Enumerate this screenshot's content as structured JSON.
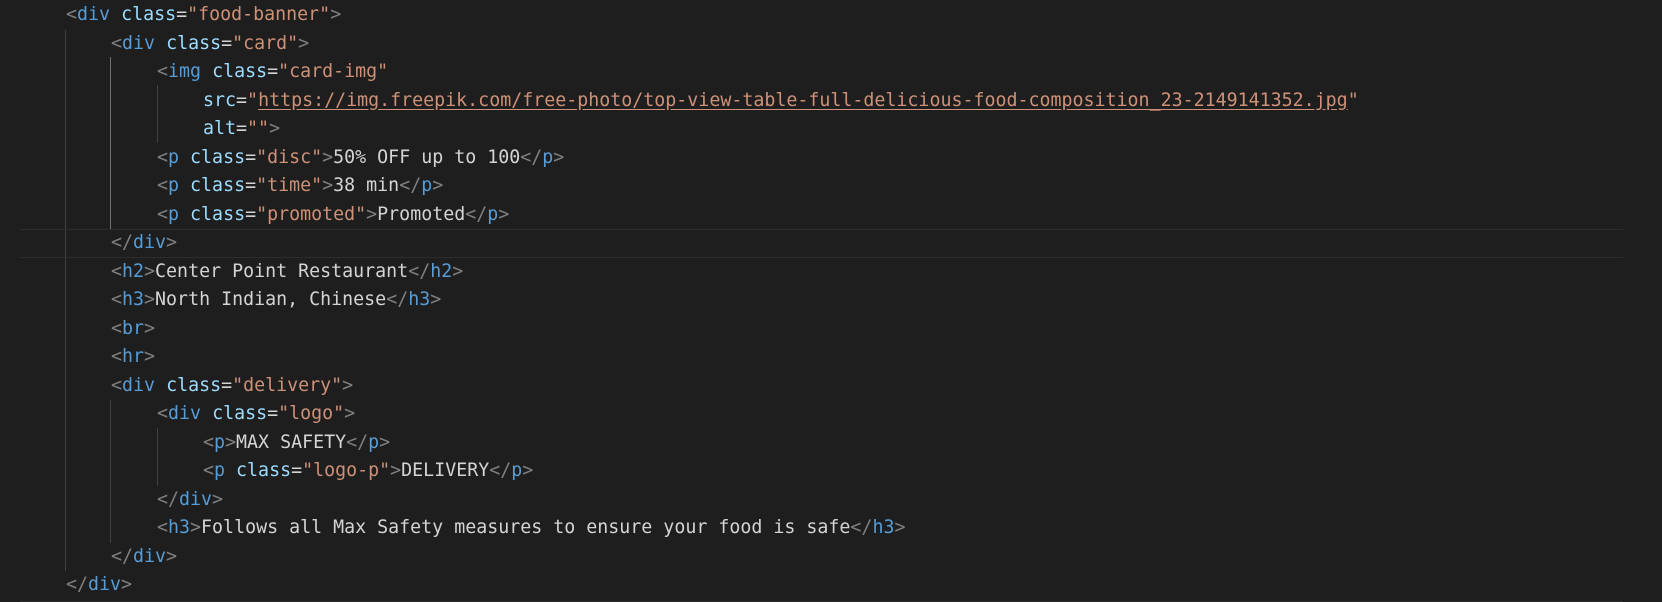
{
  "editor": {
    "lines": [
      {
        "parts": [
          [
            "t",
            "<"
          ],
          [
            "tag",
            "div"
          ],
          [
            "txt",
            " "
          ],
          [
            "attr",
            "class"
          ],
          [
            "txt",
            "="
          ],
          [
            "str",
            "\"food-banner\""
          ],
          [
            "t",
            ">"
          ]
        ]
      },
      {
        "parts": [
          [
            "t",
            "<"
          ],
          [
            "tag",
            "div"
          ],
          [
            "txt",
            " "
          ],
          [
            "attr",
            "class"
          ],
          [
            "txt",
            "="
          ],
          [
            "str",
            "\"card\""
          ],
          [
            "t",
            ">"
          ]
        ]
      },
      {
        "parts": [
          [
            "t",
            "<"
          ],
          [
            "tag",
            "img"
          ],
          [
            "txt",
            " "
          ],
          [
            "attr",
            "class"
          ],
          [
            "txt",
            "="
          ],
          [
            "str",
            "\"card-img\""
          ]
        ]
      },
      {
        "parts": [
          [
            "attr",
            "src"
          ],
          [
            "txt",
            "="
          ],
          [
            "str",
            "\""
          ],
          [
            "url",
            "https://img.freepik.com/free-photo/top-view-table-full-delicious-food-composition_23-2149141352.jpg"
          ],
          [
            "str",
            "\""
          ]
        ]
      },
      {
        "parts": [
          [
            "attr",
            "alt"
          ],
          [
            "txt",
            "="
          ],
          [
            "str",
            "\"\""
          ],
          [
            "t",
            ">"
          ]
        ]
      },
      {
        "parts": [
          [
            "t",
            "<"
          ],
          [
            "tag",
            "p"
          ],
          [
            "txt",
            " "
          ],
          [
            "attr",
            "class"
          ],
          [
            "txt",
            "="
          ],
          [
            "str",
            "\"disc\""
          ],
          [
            "t",
            ">"
          ],
          [
            "txt",
            "50% OFF up to 100"
          ],
          [
            "t",
            "</"
          ],
          [
            "tag",
            "p"
          ],
          [
            "t",
            ">"
          ]
        ]
      },
      {
        "parts": [
          [
            "t",
            "<"
          ],
          [
            "tag",
            "p"
          ],
          [
            "txt",
            " "
          ],
          [
            "attr",
            "class"
          ],
          [
            "txt",
            "="
          ],
          [
            "str",
            "\"time\""
          ],
          [
            "t",
            ">"
          ],
          [
            "txt",
            "38 min"
          ],
          [
            "t",
            "</"
          ],
          [
            "tag",
            "p"
          ],
          [
            "t",
            ">"
          ]
        ]
      },
      {
        "parts": [
          [
            "t",
            "<"
          ],
          [
            "tag",
            "p"
          ],
          [
            "txt",
            " "
          ],
          [
            "attr",
            "class"
          ],
          [
            "txt",
            "="
          ],
          [
            "str",
            "\"promoted\""
          ],
          [
            "t",
            ">"
          ],
          [
            "txt",
            "Promoted"
          ],
          [
            "t",
            "</"
          ],
          [
            "tag",
            "p"
          ],
          [
            "t",
            ">"
          ]
        ]
      },
      {
        "parts": [
          [
            "t",
            "</"
          ],
          [
            "tag",
            "div"
          ],
          [
            "t",
            ">"
          ]
        ]
      },
      {
        "parts": [
          [
            "t",
            "<"
          ],
          [
            "tag",
            "h2"
          ],
          [
            "t",
            ">"
          ],
          [
            "txt",
            "Center Point Restaurant"
          ],
          [
            "t",
            "</"
          ],
          [
            "tag",
            "h2"
          ],
          [
            "t",
            ">"
          ]
        ]
      },
      {
        "parts": [
          [
            "t",
            "<"
          ],
          [
            "tag",
            "h3"
          ],
          [
            "t",
            ">"
          ],
          [
            "txt",
            "North Indian, Chinese"
          ],
          [
            "t",
            "</"
          ],
          [
            "tag",
            "h3"
          ],
          [
            "t",
            ">"
          ]
        ]
      },
      {
        "parts": [
          [
            "t",
            "<"
          ],
          [
            "tag",
            "br"
          ],
          [
            "t",
            ">"
          ]
        ]
      },
      {
        "parts": [
          [
            "t",
            "<"
          ],
          [
            "tag",
            "hr"
          ],
          [
            "t",
            ">"
          ]
        ]
      },
      {
        "parts": [
          [
            "t",
            "<"
          ],
          [
            "tag",
            "div"
          ],
          [
            "txt",
            " "
          ],
          [
            "attr",
            "class"
          ],
          [
            "txt",
            "="
          ],
          [
            "str",
            "\"delivery\""
          ],
          [
            "t",
            ">"
          ]
        ]
      },
      {
        "parts": [
          [
            "t",
            "<"
          ],
          [
            "tag",
            "div"
          ],
          [
            "txt",
            " "
          ],
          [
            "attr",
            "class"
          ],
          [
            "txt",
            "="
          ],
          [
            "str",
            "\"logo\""
          ],
          [
            "t",
            ">"
          ]
        ]
      },
      {
        "parts": [
          [
            "t",
            "<"
          ],
          [
            "tag",
            "p"
          ],
          [
            "t",
            ">"
          ],
          [
            "txt",
            "MAX SAFETY"
          ],
          [
            "t",
            "</"
          ],
          [
            "tag",
            "p"
          ],
          [
            "t",
            ">"
          ]
        ]
      },
      {
        "parts": [
          [
            "t",
            "<"
          ],
          [
            "tag",
            "p"
          ],
          [
            "txt",
            " "
          ],
          [
            "attr",
            "class"
          ],
          [
            "txt",
            "="
          ],
          [
            "str",
            "\"logo-p\""
          ],
          [
            "t",
            ">"
          ],
          [
            "txt",
            "DELIVERY"
          ],
          [
            "t",
            "</"
          ],
          [
            "tag",
            "p"
          ],
          [
            "t",
            ">"
          ]
        ]
      },
      {
        "parts": [
          [
            "t",
            "</"
          ],
          [
            "tag",
            "div"
          ],
          [
            "t",
            ">"
          ]
        ]
      },
      {
        "parts": [
          [
            "t",
            "<"
          ],
          [
            "tag",
            "h3"
          ],
          [
            "t",
            ">"
          ],
          [
            "txt",
            "Follows all Max Safety measures to ensure your food is safe"
          ],
          [
            "t",
            "</"
          ],
          [
            "tag",
            "h3"
          ],
          [
            "t",
            ">"
          ]
        ]
      },
      {
        "parts": [
          [
            "t",
            "</"
          ],
          [
            "tag",
            "div"
          ],
          [
            "t",
            ">"
          ]
        ]
      },
      {
        "parts": [
          [
            "t",
            "</"
          ],
          [
            "tag",
            "div"
          ],
          [
            "t",
            ">"
          ]
        ]
      }
    ]
  }
}
